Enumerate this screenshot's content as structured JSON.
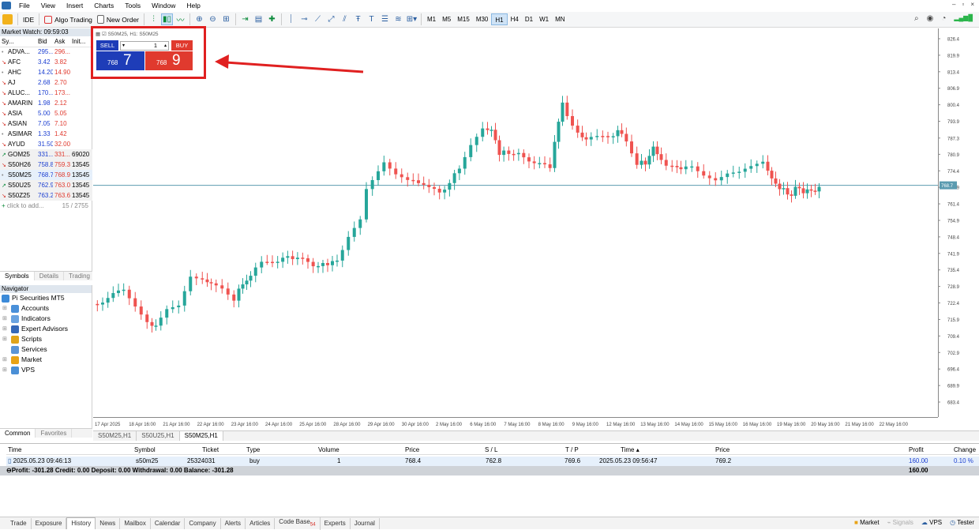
{
  "menu": [
    "File",
    "View",
    "Insert",
    "Charts",
    "Tools",
    "Window",
    "Help"
  ],
  "toolbar": {
    "ide": "IDE",
    "algo": "Algo Trading",
    "new_order": "New Order",
    "timeframes": [
      "M1",
      "M5",
      "M15",
      "M30",
      "H1",
      "H4",
      "D1",
      "W1",
      "MN"
    ],
    "active_tf": "H1"
  },
  "market_watch": {
    "title": "Market Watch: 09:59:03",
    "headers": [
      "Sy...",
      "Bid",
      "Ask",
      "Init..."
    ],
    "rows": [
      {
        "dir": "neu",
        "sym": "ADVA...",
        "bid": "295...",
        "ask": "296...",
        "init": ""
      },
      {
        "dir": "dn",
        "sym": "AFC",
        "bid": "3.42",
        "ask": "3.82",
        "init": ""
      },
      {
        "dir": "neu",
        "sym": "AHC",
        "bid": "14.20",
        "ask": "14.90",
        "init": ""
      },
      {
        "dir": "dn",
        "sym": "AJ",
        "bid": "2.68",
        "ask": "2.70",
        "init": ""
      },
      {
        "dir": "dn",
        "sym": "ALUC...",
        "bid": "170...",
        "ask": "173...",
        "init": ""
      },
      {
        "dir": "dn",
        "sym": "AMARIN",
        "bid": "1.98",
        "ask": "2.12",
        "init": ""
      },
      {
        "dir": "dn",
        "sym": "ASIA",
        "bid": "5.00",
        "ask": "5.05",
        "init": ""
      },
      {
        "dir": "dn",
        "sym": "ASIAN",
        "bid": "7.05",
        "ask": "7.10",
        "init": ""
      },
      {
        "dir": "neu",
        "sym": "ASIMAR",
        "bid": "1.33",
        "ask": "1.42",
        "init": ""
      },
      {
        "dir": "dn",
        "sym": "AYUD",
        "bid": "31.50",
        "ask": "32.00",
        "init": ""
      },
      {
        "dir": "up",
        "sym": "GOM25",
        "bid": "331...",
        "ask": "331...",
        "init": "69020"
      },
      {
        "dir": "dn",
        "sym": "S50H26",
        "bid": "758.8",
        "ask": "759.3",
        "init": "13545"
      },
      {
        "dir": "neu",
        "sym": "S50M25",
        "bid": "768.7",
        "ask": "768.9",
        "init": "13545"
      },
      {
        "dir": "up",
        "sym": "S50U25",
        "bid": "762.9",
        "ask": "763.0",
        "init": "13545"
      },
      {
        "dir": "dn",
        "sym": "S50Z25",
        "bid": "763.2",
        "ask": "763.6",
        "init": "13545"
      }
    ],
    "add_label": "click to add...",
    "count": "15 / 2755",
    "tabs": [
      "Symbols",
      "Details",
      "Trading"
    ]
  },
  "navigator": {
    "title": "Navigator",
    "root": "Pi Securities MT5",
    "items": [
      "Accounts",
      "Indicators",
      "Expert Advisors",
      "Scripts",
      "Services",
      "Market",
      "VPS"
    ],
    "tabs": [
      "Common",
      "Favorites"
    ]
  },
  "one_click": {
    "title": "S50M25, H1:  S50M25",
    "sell": "SELL",
    "buy": "BUY",
    "lot": "1",
    "sell_small": "768",
    "sell_big": "7",
    "buy_small": "768",
    "buy_big": "9"
  },
  "chart_tabs": [
    "S50M25,H1",
    "S50U25,H1",
    "S50M25,H1"
  ],
  "chart": {
    "price_labels": [
      "826.4",
      "819.9",
      "813.4",
      "806.9",
      "800.4",
      "793.9",
      "787.3",
      "780.9",
      "774.4",
      "767.9",
      "761.4",
      "754.9",
      "748.4",
      "741.9",
      "735.4",
      "728.9",
      "722.4",
      "715.9",
      "709.4",
      "702.9",
      "696.4",
      "689.9",
      "683.4"
    ],
    "current_price": "768.7",
    "date_labels": [
      "17 Apr 2025",
      "18 Apr 16:00",
      "21 Apr 16:00",
      "22 Apr 16:00",
      "23 Apr 16:00",
      "24 Apr 16:00",
      "25 Apr 16:00",
      "28 Apr 16:00",
      "29 Apr 16:00",
      "30 Apr 16:00",
      "2 May 16:00",
      "6 May 16:00",
      "7 May 16:00",
      "8 May 16:00",
      "9 May 16:00",
      "12 May 16:00",
      "13 May 16:00",
      "14 May 16:00",
      "15 May 16:00",
      "16 May 16:00",
      "19 May 16:00",
      "20 May 16:00",
      "21 May 16:00",
      "22 May 16:00"
    ],
    "up_color": "#26a69a",
    "down_color": "#ef5350"
  },
  "terminal": {
    "headers": [
      "Time",
      "Symbol",
      "Ticket",
      "Type",
      "Volume",
      "Price",
      "S / L",
      "T / P",
      "Time",
      "Price",
      "Profit",
      "Change"
    ],
    "row": [
      "2025.05.23 09:46:13",
      "s50m25",
      "25324031",
      "buy",
      "1",
      "768.4",
      "762.8",
      "769.6",
      "2025.05.23 09:56:47",
      "769.2",
      "160.00",
      "0.10 %"
    ],
    "summary": "Profit: -301.28  Credit: 0.00  Deposit: 0.00  Withdrawal: 0.00  Balance: -301.28",
    "summary_profit": "160.00"
  },
  "bottom_tabs": [
    "Trade",
    "Exposure",
    "History",
    "News",
    "Mailbox",
    "Calendar",
    "Company",
    "Alerts",
    "Articles",
    "Code Base",
    "Experts",
    "Journal"
  ],
  "code_base_badge": "54",
  "status": {
    "market": "Market",
    "signals": "Signals",
    "vps": "VPS",
    "tester": "Tester"
  }
}
